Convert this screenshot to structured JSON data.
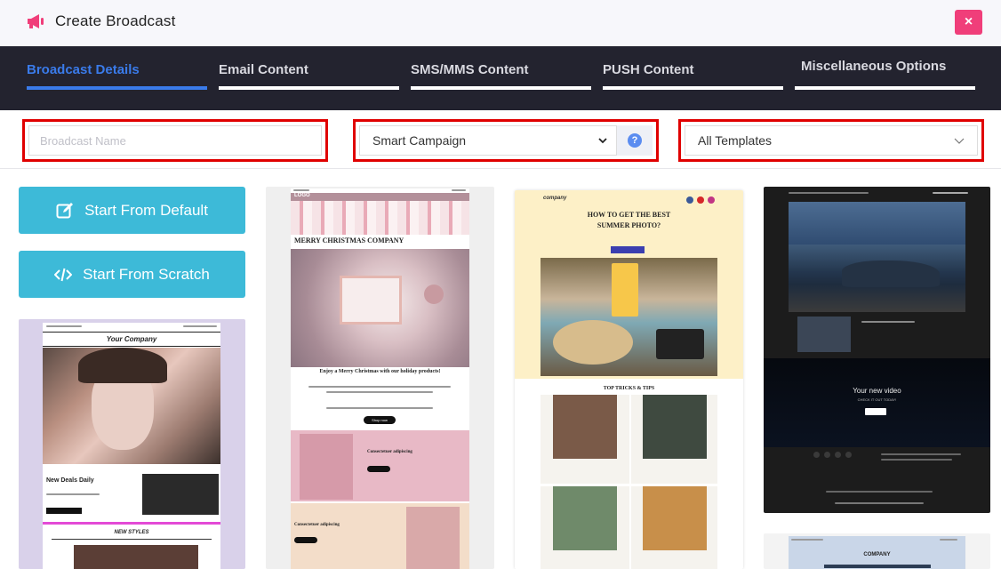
{
  "header": {
    "title": "Create Broadcast",
    "close_label": "×",
    "brand_color": "#f03e7a"
  },
  "tabs": [
    {
      "label": "Broadcast Details",
      "active": true
    },
    {
      "label": "Email Content",
      "active": false
    },
    {
      "label": "SMS/MMS Content",
      "active": false
    },
    {
      "label": "PUSH Content",
      "active": false
    },
    {
      "label": "Miscellaneous Options",
      "active": false
    }
  ],
  "filters": {
    "broadcast_name": {
      "value": "",
      "placeholder": "Broadcast Name"
    },
    "campaign_type": {
      "selected": "Smart Campaign"
    },
    "help_label": "?",
    "template_filter": {
      "selected": "All Templates"
    }
  },
  "actions": {
    "start_default": "Start From Default",
    "start_scratch": "Start From Scratch"
  },
  "templates": {
    "t1": {
      "company": "Your Company",
      "headline": "New Deals Daily",
      "section": "NEW STYLES"
    },
    "t2": {
      "logo": "LOGO",
      "title": "MERRY CHRISTMAS COMPANY",
      "subtitle": "Enjoy a Merry Christmas with our holiday products!",
      "cta": "Shop now",
      "block1": "Consectetuer adipiscing",
      "block2": "Consectetuer adipiscing"
    },
    "t3": {
      "brand": "company",
      "headline": "HOW TO GET THE BEST SUMMER PHOTO?",
      "section": "TOP TRICKS & TIPS"
    },
    "t4": {
      "video_title": "Your new video",
      "video_sub": "CHECK IT OUT TODAY!"
    },
    "t5": {
      "company": "COMPANY"
    }
  },
  "colors": {
    "accent": "#3a7bea",
    "tabs_bg": "#23232f",
    "start_button": "#3dbad8",
    "highlight_border": "#e00000"
  },
  "icons": {
    "logo": "megaphone-icon",
    "help": "question-circle-icon",
    "default": "edit-icon",
    "scratch": "code-icon"
  }
}
